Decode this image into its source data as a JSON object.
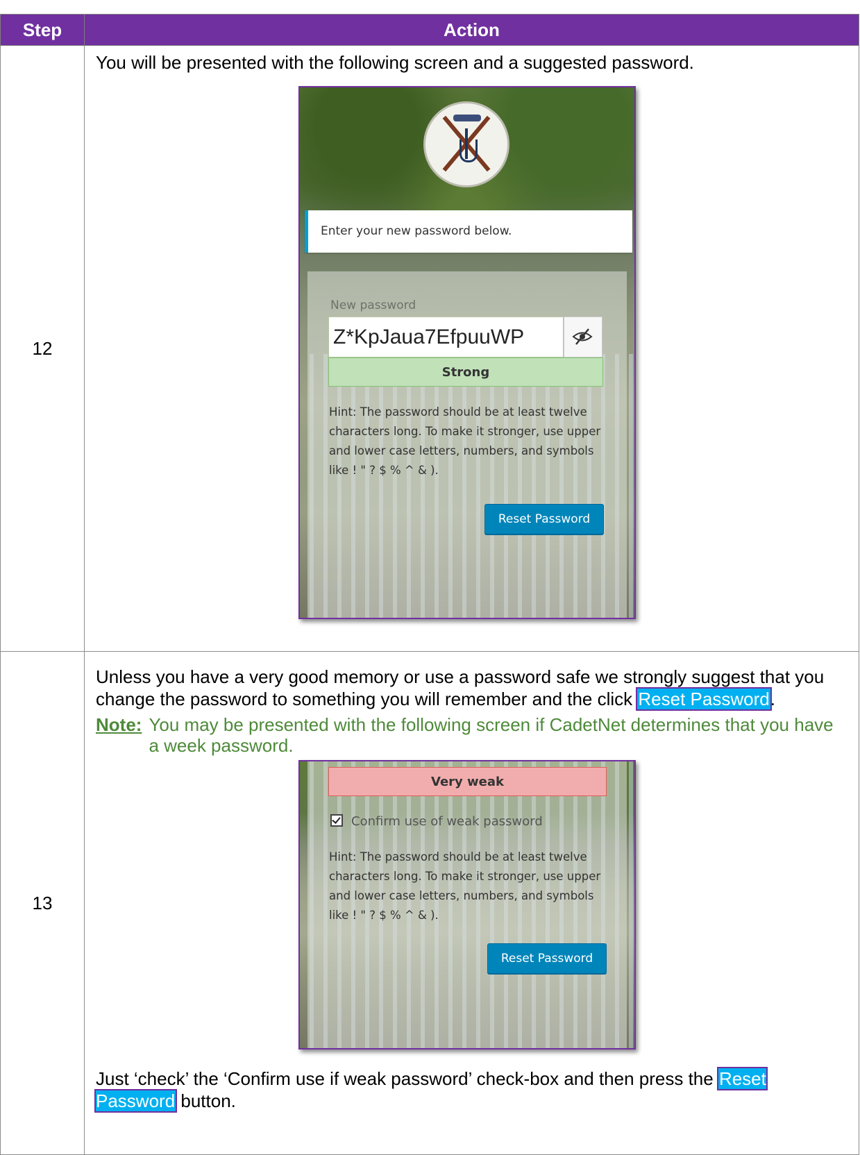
{
  "table": {
    "headers": [
      "Step",
      "Action"
    ]
  },
  "row12": {
    "step": "12",
    "text": "You will be presented with the following screen and a suggested password.",
    "screen": {
      "message": "Enter your new password below.",
      "field_label": "New password",
      "password_value": "Z*KpJaua7EfpuuWP",
      "strength": "Strong",
      "strength_color": "#c1e1b9",
      "hint": "Hint: The password should be at least twelve characters long. To make it stronger, use upper and lower case letters, numbers, and symbols like ! \" ? $ % ^ & ).",
      "button": "Reset Password"
    }
  },
  "row13": {
    "step": "13",
    "text_before": "Unless you have a very good memory or use a password safe we strongly suggest that you change the password to something you will remember and the click ",
    "text_link": "Reset Password",
    "text_after": ".",
    "note_label": "Note:",
    "note_text": "You may be presented with the following screen if CadetNet determines that you have a week password.",
    "screen": {
      "strength": "Very weak",
      "strength_color": "#f1adad",
      "confirm_label": "Confirm use of weak password",
      "hint": "Hint: The password should be at least twelve characters long. To make it stronger, use upper and lower case letters, numbers, and symbols like ! \" ? $ % ^ & ).",
      "button": "Reset Password"
    },
    "after_before": "Just ‘check’ the ‘Confirm use if weak password’ check-box and then press the ",
    "after_link": "Reset Password",
    "after_after": " button."
  },
  "colors": {
    "header_bg": "#7030a0",
    "link_highlight": "#00b0f0",
    "note_green": "#4e8a3a",
    "button_blue": "#0085ba"
  }
}
